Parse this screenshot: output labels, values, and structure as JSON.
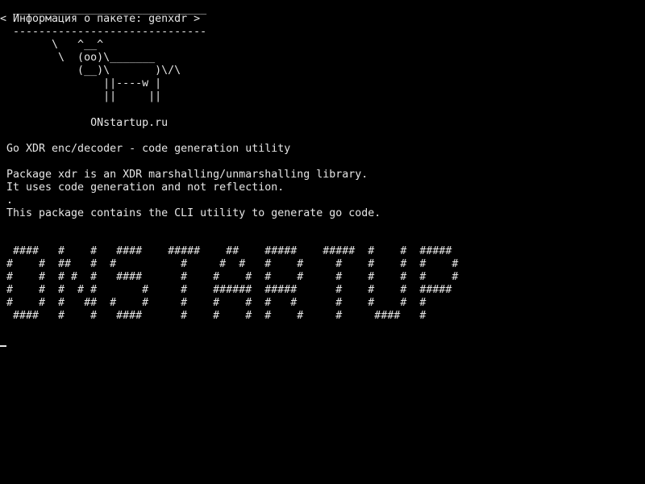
{
  "theme": {
    "background": "#000000",
    "foreground": "#e6e6e6"
  },
  "terminal": {
    "bubble_top": " ______________________________",
    "bubble_text": "< Информация о пакете: genxdr >",
    "bubble_bottom": " ------------------------------",
    "cow_lines": [
      "       \\   ^__^",
      "        \\  (oo)\\_______",
      "           (__)\\       )\\/\\",
      "               ||----w |",
      "               ||     ||"
    ],
    "site": "             ONstartup.ru",
    "description": "Go XDR enc/decoder - code generation utility",
    "info_lines": [
      "Package xdr is an XDR marshalling/unmarshalling library.",
      "It uses code generation and not reflection.",
      ".",
      "This package contains the CLI utility to generate go code."
    ],
    "banner_lines": [
      " ####   #    #   ####    #####    ##    #####    #####  #    #  #####",
      "#    #  ##   #  #          #     #  #   #    #     #    #    #  #    #",
      "#    #  # #  #   ####      #    #    #  #    #     #    #    #  #    #",
      "#    #  #  # #       #     #    ######  #####      #    #    #  #####",
      "#    #  #   ##  #    #     #    #    #  #   #      #    #    #  #",
      " ####   #    #   ####      #    #    #  #    #     #     ####   #"
    ]
  }
}
